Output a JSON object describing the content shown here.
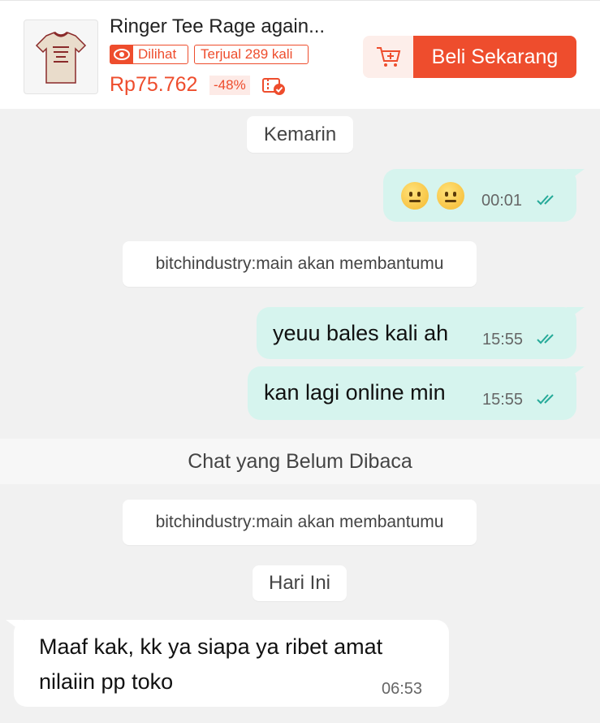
{
  "product": {
    "title": "Ringer Tee Rage again...",
    "thumb_alt": "rage against the machine",
    "viewed_label": "Dilihat",
    "sold_label": "Terjual 289 kali",
    "price": "Rp75.762",
    "discount": "-48%",
    "buy_label": "Beli Sekarang"
  },
  "chat": {
    "date_yesterday": "Kemarin",
    "system_message": "bitchindustry:main akan membantumu",
    "unread_label": "Chat yang Belum Dibaca",
    "date_today": "Hari Ini",
    "messages": [
      {
        "text": "😐😐",
        "time": "00:01",
        "direction": "out"
      },
      {
        "text": "yeuu bales kali ah",
        "time": "15:55",
        "direction": "out"
      },
      {
        "text": "kan lagi online min",
        "time": "15:55",
        "direction": "out"
      },
      {
        "text": "Maaf kak, kk ya siapa ya ribet amat",
        "text2": "nilaiin pp toko",
        "time": "06:53",
        "direction": "in"
      }
    ]
  },
  "colors": {
    "accent": "#ee4d2d",
    "outgoing_bubble": "#d6f4ee",
    "read_ticks": "#26aa99"
  },
  "icons": [
    "eye-icon",
    "cart-plus-icon",
    "voucher-icon",
    "double-check-icon"
  ]
}
